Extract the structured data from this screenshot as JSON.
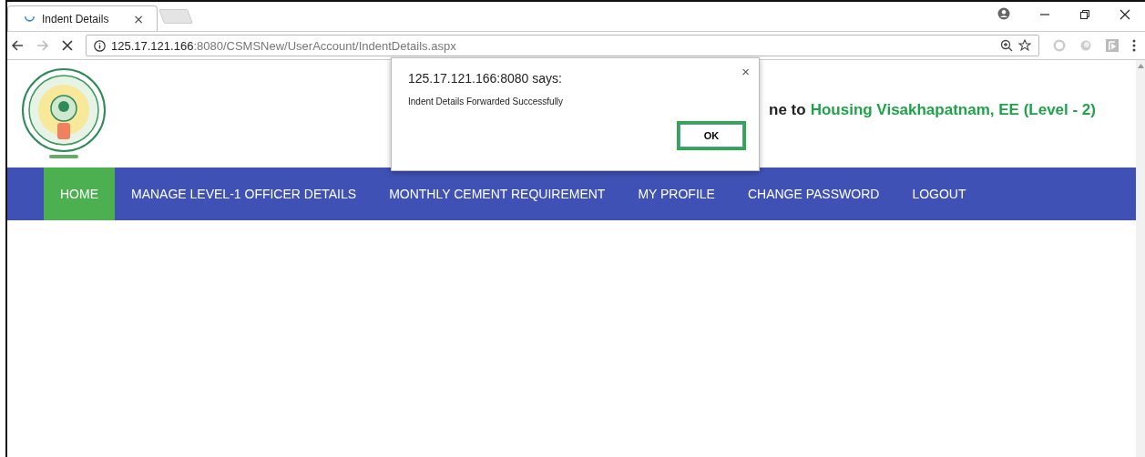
{
  "browser": {
    "tab": {
      "title": "Indent Details",
      "close": "×"
    },
    "address": {
      "host": "125.17.121.166",
      "path": ":8080/CSMSNew/UserAccount/IndentDetails.aspx"
    }
  },
  "header": {
    "welcome_prefix": "ne to",
    "welcome_name": "Housing Visakhapatnam, EE (Level - 2)"
  },
  "nav": [
    {
      "label": "HOME",
      "selected": true
    },
    {
      "label": "MANAGE LEVEL-1 OFFICER DETAILS",
      "selected": false
    },
    {
      "label": "MONTHLY CEMENT REQUIREMENT",
      "selected": false
    },
    {
      "label": "MY PROFILE",
      "selected": false
    },
    {
      "label": "CHANGE PASSWORD",
      "selected": false
    },
    {
      "label": "LOGOUT",
      "selected": false
    }
  ],
  "dialog": {
    "title": "125.17.121.166:8080 says:",
    "message": "Indent Details Forwarded Successfully",
    "close": "×",
    "button": "OK"
  }
}
